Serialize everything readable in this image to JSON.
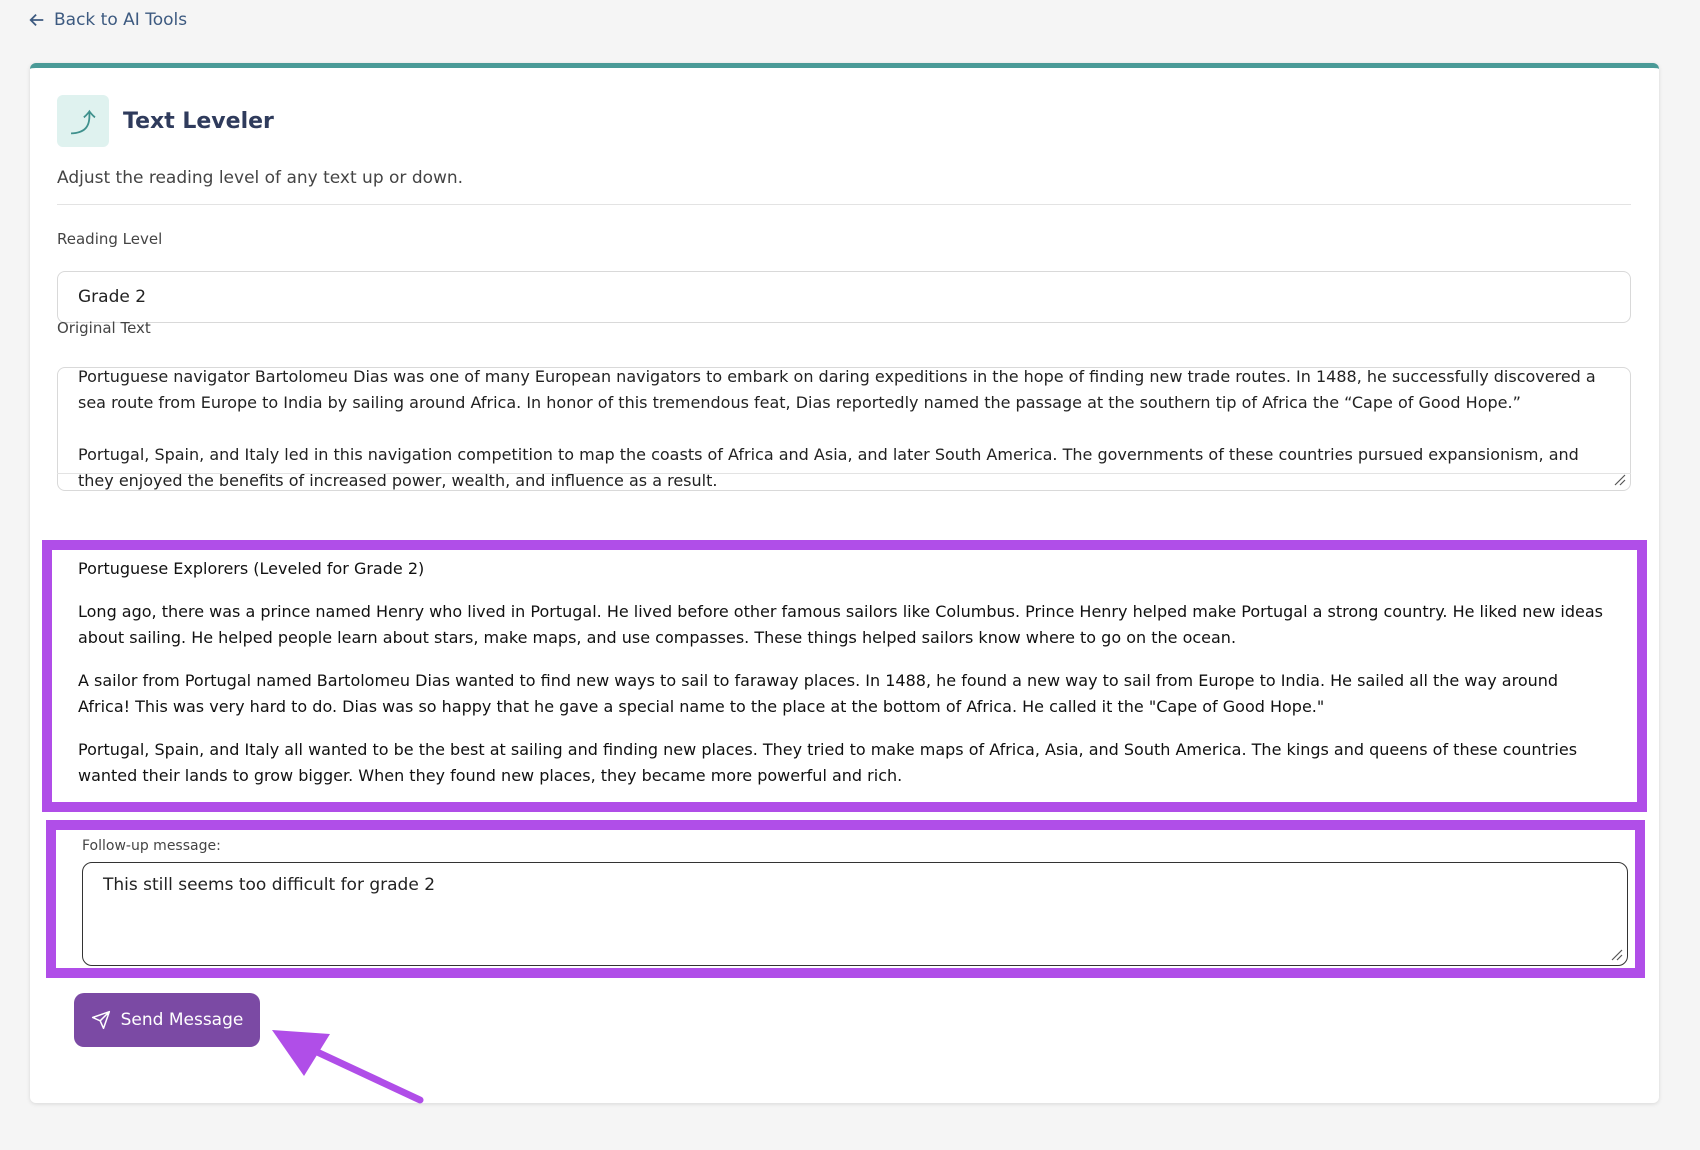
{
  "nav": {
    "back_label": "Back to AI Tools"
  },
  "tool": {
    "icon": "level-up-icon",
    "title": "Text Leveler",
    "description": "Adjust the reading level of any text up or down."
  },
  "form": {
    "reading_level_label": "Reading Level",
    "reading_level_value": "Grade 2",
    "original_text_label": "Original Text",
    "original_text_paragraphs": [
      "Portuguese navigator Bartolomeu Dias was one of many European navigators to embark on daring expeditions in the hope of finding new trade routes. In 1488, he successfully discovered a sea route from Europe to India by sailing around Africa. In honor of this tremendous feat, Dias reportedly named the passage at the southern tip of Africa the “Cape of Good Hope.”",
      "Portugal, Spain, and Italy led in this navigation competition to map the coasts of Africa and Asia, and later South America. The governments of these countries pursued expansionism, and they enjoyed the benefits of increased power, wealth, and influence as a result."
    ]
  },
  "output": {
    "title": "Portuguese Explorers (Leveled for Grade 2)",
    "paragraphs": [
      "Long ago, there was a prince named Henry who lived in Portugal. He lived before other famous sailors like Columbus. Prince Henry helped make Portugal a strong country. He liked new ideas about sailing. He helped people learn about stars, make maps, and use compasses. These things helped sailors know where to go on the ocean.",
      "A sailor from Portugal named Bartolomeu Dias wanted to find new ways to sail to faraway places. In 1488, he found a new way to sail from Europe to India. He sailed all the way around Africa! This was very hard to do. Dias was so happy that he gave a special name to the place at the bottom of Africa. He called it the \"Cape of Good Hope.\"",
      "Portugal, Spain, and Italy all wanted to be the best at sailing and finding new places. They tried to make maps of Africa, Asia, and South America. The kings and queens of these countries wanted their lands to grow bigger. When they found new places, they became more powerful and rich."
    ]
  },
  "followup": {
    "label": "Follow-up message:",
    "value": "This still seems too difficult for grade 2",
    "send_label": "Send Message"
  },
  "colors": {
    "accent_teal": "#4a9a97",
    "button_purple": "#7b4aa4",
    "highlight_purple": "#b04ee8"
  }
}
